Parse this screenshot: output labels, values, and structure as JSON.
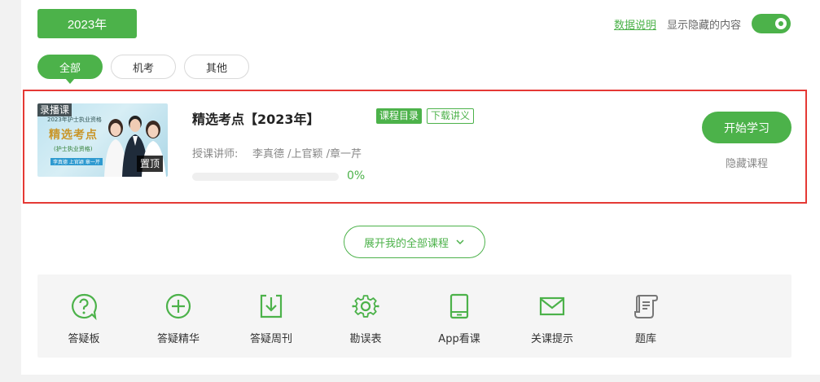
{
  "header": {
    "year_label": "2023年",
    "data_link": "数据说明",
    "show_hidden_label": "显示隐藏的内容",
    "show_hidden_on": true
  },
  "filters": {
    "tabs": [
      {
        "label": "全部",
        "active": true
      },
      {
        "label": "机考",
        "active": false
      },
      {
        "label": "其他",
        "active": false
      }
    ]
  },
  "course": {
    "thumb_badge": "录播课",
    "thumb_small_text": "2023年护士执业资格",
    "thumb_headline": "精选考点",
    "thumb_sub": "(护士执业资格)",
    "thumb_sub2": "李真德 上官颖 章一芹",
    "pin_label": "置顶",
    "title": "精选考点【2023年】",
    "tag_catalog": "课程目录",
    "tag_download": "下载讲义",
    "teacher_label": "授课讲师:",
    "teachers": "李真德 /上官颖 /章一芹",
    "progress_percent": 0,
    "progress_text": "0%",
    "start_button": "开始学习",
    "hide_button": "隐藏课程"
  },
  "expand_label": "展开我的全部课程",
  "tools": [
    {
      "label": "答疑板",
      "icon": "question-bubble-icon"
    },
    {
      "label": "答疑精华",
      "icon": "plus-circle-icon"
    },
    {
      "label": "答疑周刊",
      "icon": "download-box-icon"
    },
    {
      "label": "勘误表",
      "icon": "gear-icon"
    },
    {
      "label": "App看课",
      "icon": "tablet-icon"
    },
    {
      "label": "关课提示",
      "icon": "envelope-icon"
    },
    {
      "label": "题库",
      "icon": "scroll-icon"
    }
  ],
  "colors": {
    "accent": "#4cb24a",
    "highlight_border": "#e53935"
  }
}
